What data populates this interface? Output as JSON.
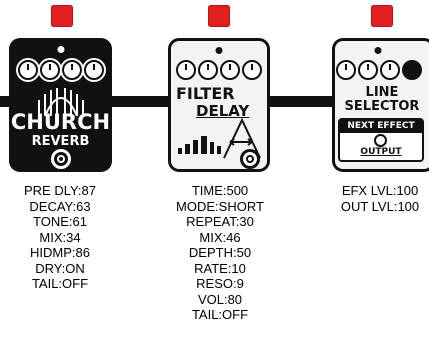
{
  "chain": {
    "pedals": [
      {
        "name_line1": "CHURCH",
        "name_line2": "REVERB",
        "params": [
          "PRE DLY:87",
          "DECAY:63",
          "TONE:61",
          "MIX:34",
          "HIDMP:86",
          "DRY:ON",
          "TAIL:OFF"
        ]
      },
      {
        "name_line1": "FILTER",
        "name_line2": "DELAY",
        "params": [
          "TIME:500",
          "MODE:SHORT",
          "REPEAT:30",
          "MIX:46",
          "DEPTH:50",
          "RATE:10",
          "RESO:9",
          "VOL:80",
          "TAIL:OFF"
        ]
      },
      {
        "name_line1": "LINE",
        "name_line2": "SELECTOR",
        "sub_label": "NEXT EFFECT",
        "output_label": "OUTPUT",
        "params": [
          "EFX LVL:100",
          "OUT LVL:100"
        ]
      }
    ]
  },
  "colors": {
    "led": "#e31e1e",
    "pedal": "#111111",
    "face": "#f3f3f3"
  }
}
